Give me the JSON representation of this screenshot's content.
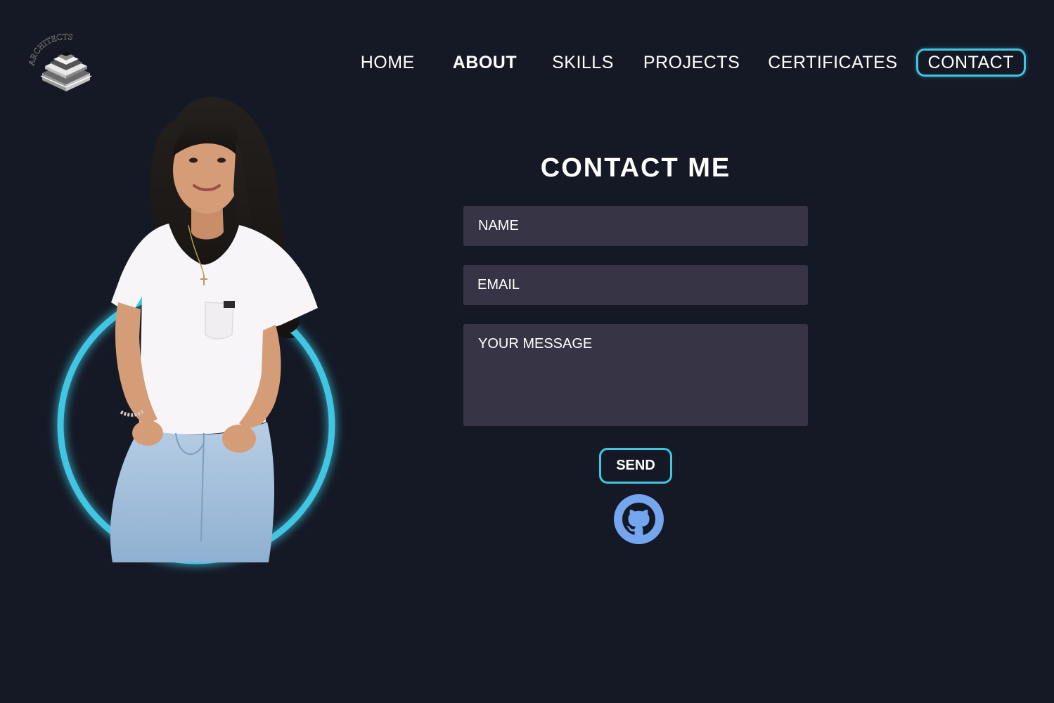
{
  "header": {
    "logo_text": "ARCHITECTS",
    "nav": {
      "home": "HOME",
      "about": "ABOUT",
      "skills": "SKILLS",
      "projects": "PROJECTS",
      "certificates": "CERTIFICATES",
      "contact": "CONTACT"
    },
    "active_item": "CONTACT"
  },
  "contact": {
    "title": "CONTACT ME",
    "name_placeholder": "NAME",
    "email_placeholder": "EMAIL",
    "message_placeholder": "YOUR MESSAGE",
    "send_label": "SEND",
    "social_icon": "github-icon"
  },
  "colors": {
    "background": "#151925",
    "accent": "#41c6e2",
    "field_background": "#373545",
    "github_icon": "#74a6f0",
    "text": "#ffffff"
  },
  "portrait": {
    "icon": "person-portrait-photo"
  }
}
